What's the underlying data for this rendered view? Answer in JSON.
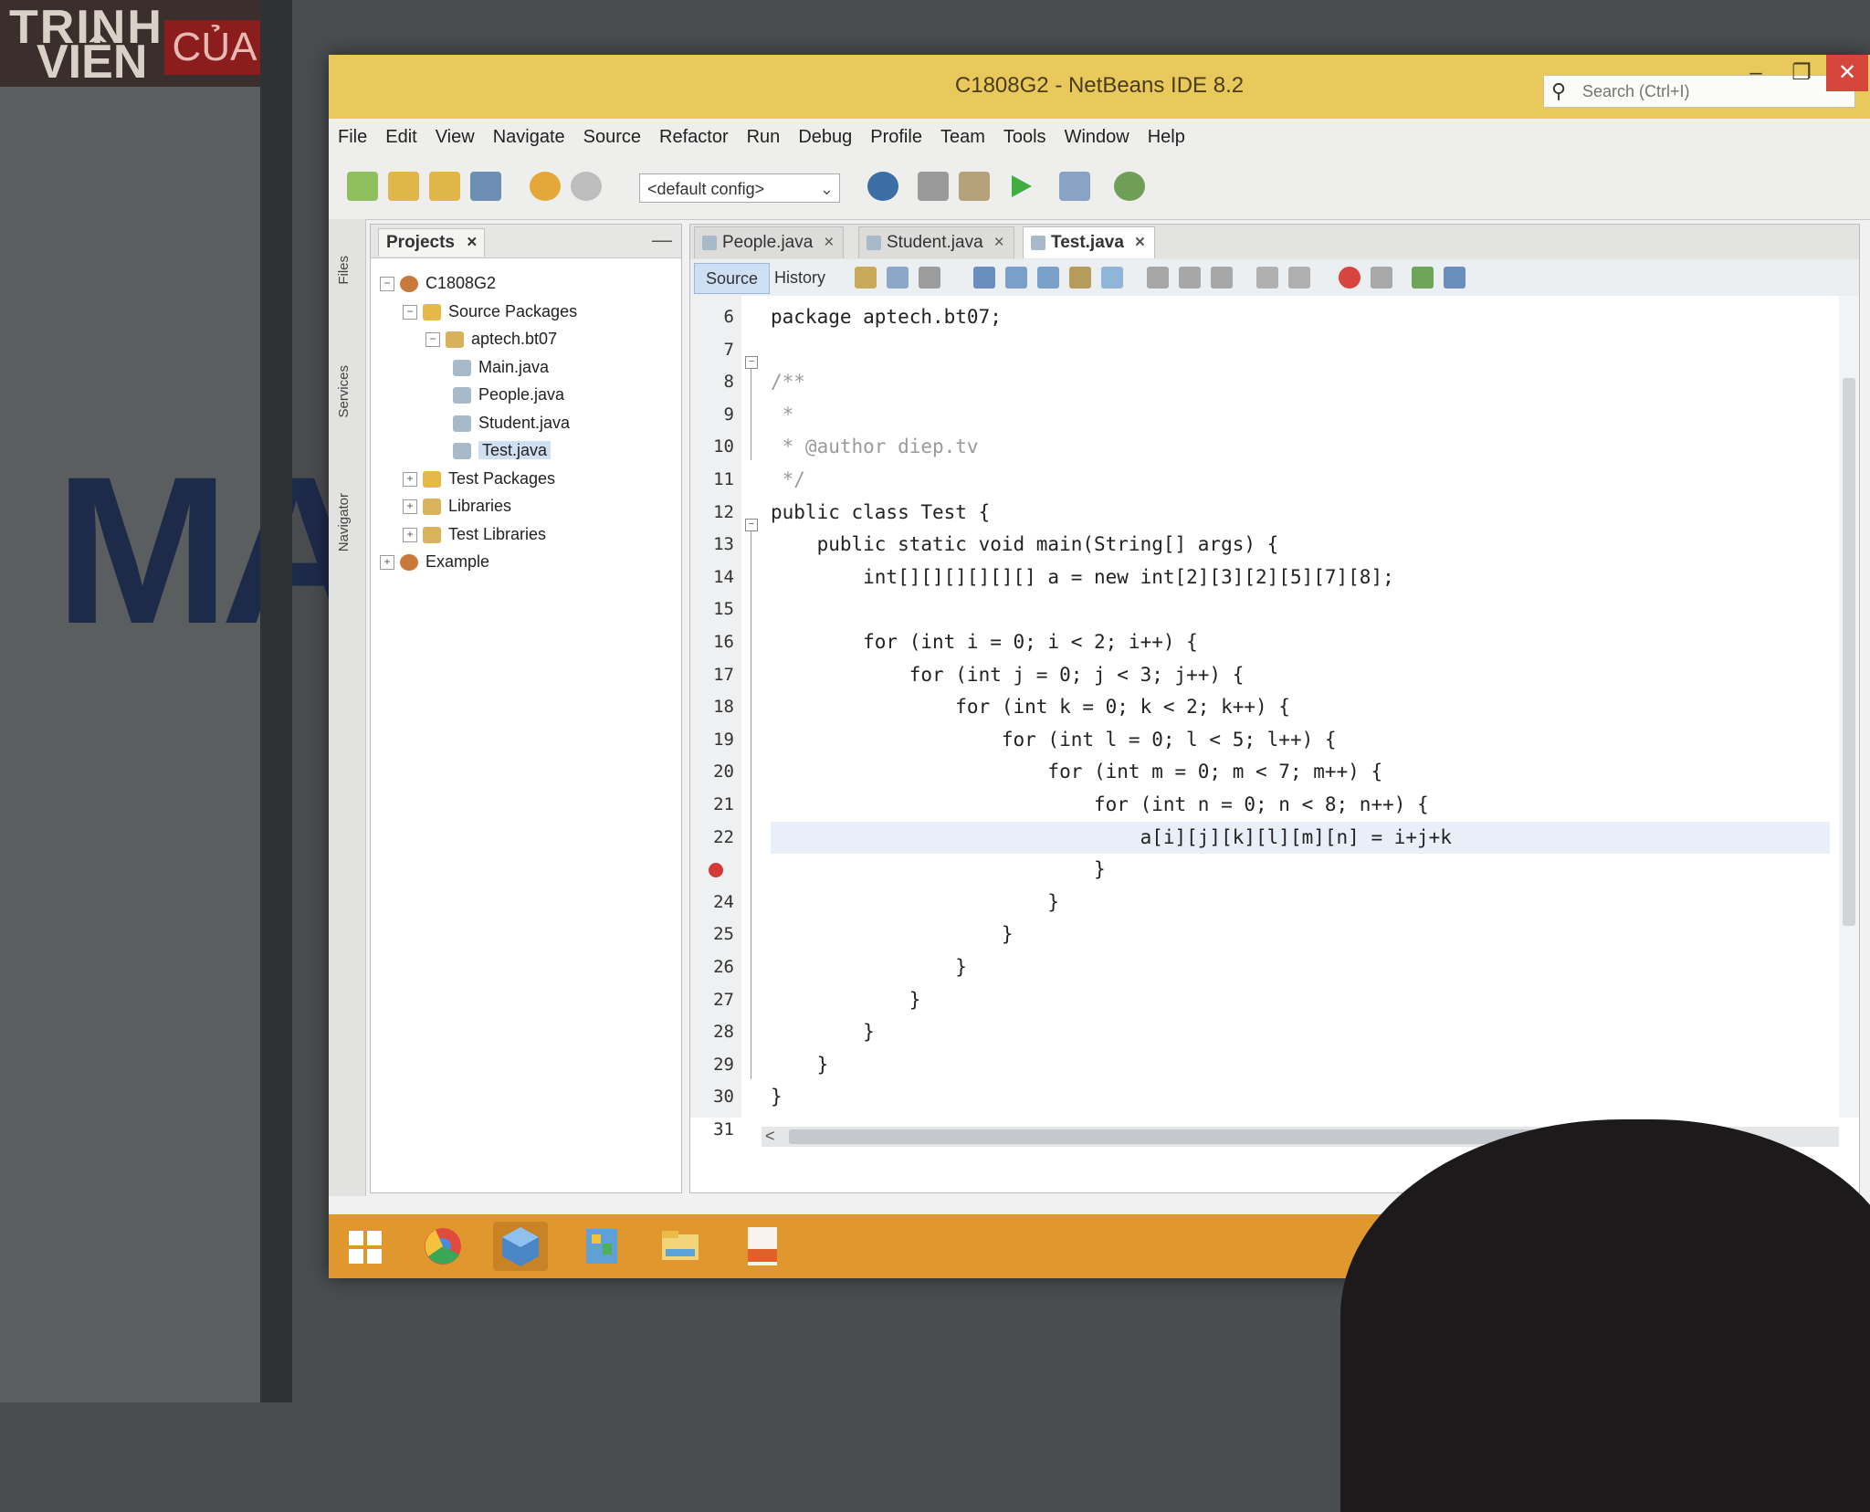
{
  "window": {
    "title": "C1808G2 - NetBeans IDE 8.2",
    "search_placeholder": "Search (Ctrl+I)",
    "minimize": "–",
    "restore": "❐",
    "close": "✕"
  },
  "menu": [
    "File",
    "Edit",
    "View",
    "Navigate",
    "Source",
    "Refactor",
    "Run",
    "Debug",
    "Profile",
    "Team",
    "Tools",
    "Window",
    "Help"
  ],
  "toolbar": {
    "config": "<default config>"
  },
  "side_strip": {
    "files": "Files",
    "services": "Services",
    "navigator": "Navigator"
  },
  "projects": {
    "tab_label": "Projects",
    "close": "×",
    "minimize": "—",
    "tree": [
      {
        "label": "C1808G2",
        "toggle": "−"
      },
      {
        "label": "Source Packages",
        "toggle": "−"
      },
      {
        "label": "aptech.bt07",
        "toggle": "−"
      },
      {
        "label": "Main.java"
      },
      {
        "label": "People.java"
      },
      {
        "label": "Student.java"
      },
      {
        "label": "Test.java"
      },
      {
        "label": "Test Packages",
        "toggle": "+"
      },
      {
        "label": "Libraries",
        "toggle": "+"
      },
      {
        "label": "Test Libraries",
        "toggle": "+"
      },
      {
        "label": "Example",
        "toggle": "+"
      }
    ]
  },
  "editor": {
    "tabs": [
      {
        "label": "People.java",
        "close": "×"
      },
      {
        "label": "Student.java",
        "close": "×"
      },
      {
        "label": "Test.java",
        "close": "×"
      }
    ],
    "source_tab": "Source",
    "history_tab": "History",
    "scroll_left": "<",
    "lines": [
      {
        "n": "6",
        "code": "package aptech.bt07;"
      },
      {
        "n": "7",
        "code": ""
      },
      {
        "n": "8",
        "code": "/**"
      },
      {
        "n": "9",
        "code": " *"
      },
      {
        "n": "10",
        "code": " * @author diep.tv"
      },
      {
        "n": "11",
        "code": " */"
      },
      {
        "n": "12",
        "code": "public class Test {"
      },
      {
        "n": "13",
        "code": "    public static void main(String[] args) {"
      },
      {
        "n": "14",
        "code": "        int[][][][][][] a = new int[2][3][2][5][7][8];"
      },
      {
        "n": "15",
        "code": ""
      },
      {
        "n": "16",
        "code": "        for (int i = 0; i < 2; i++) {"
      },
      {
        "n": "17",
        "code": "            for (int j = 0; j < 3; j++) {"
      },
      {
        "n": "18",
        "code": "                for (int k = 0; k < 2; k++) {"
      },
      {
        "n": "19",
        "code": "                    for (int l = 0; l < 5; l++) {"
      },
      {
        "n": "20",
        "code": "                        for (int m = 0; m < 7; m++) {"
      },
      {
        "n": "21",
        "code": "                            for (int n = 0; n < 8; n++) {"
      },
      {
        "n": "22",
        "code": "                                a[i][j][k][l][m][n] = i+j+k"
      },
      {
        "n": "",
        "code": "                            }"
      },
      {
        "n": "24",
        "code": "                        }"
      },
      {
        "n": "25",
        "code": "                    }"
      },
      {
        "n": "26",
        "code": "                }"
      },
      {
        "n": "27",
        "code": "            }"
      },
      {
        "n": "28",
        "code": "        }"
      },
      {
        "n": "29",
        "code": "    }"
      },
      {
        "n": "30",
        "code": "}"
      },
      {
        "n": "31",
        "code": ""
      }
    ]
  },
  "background": {
    "banner_line1": "TRINH",
    "banner_line2": "VIÊN",
    "banner_line3": "CỦA",
    "poster_text": "MA"
  }
}
